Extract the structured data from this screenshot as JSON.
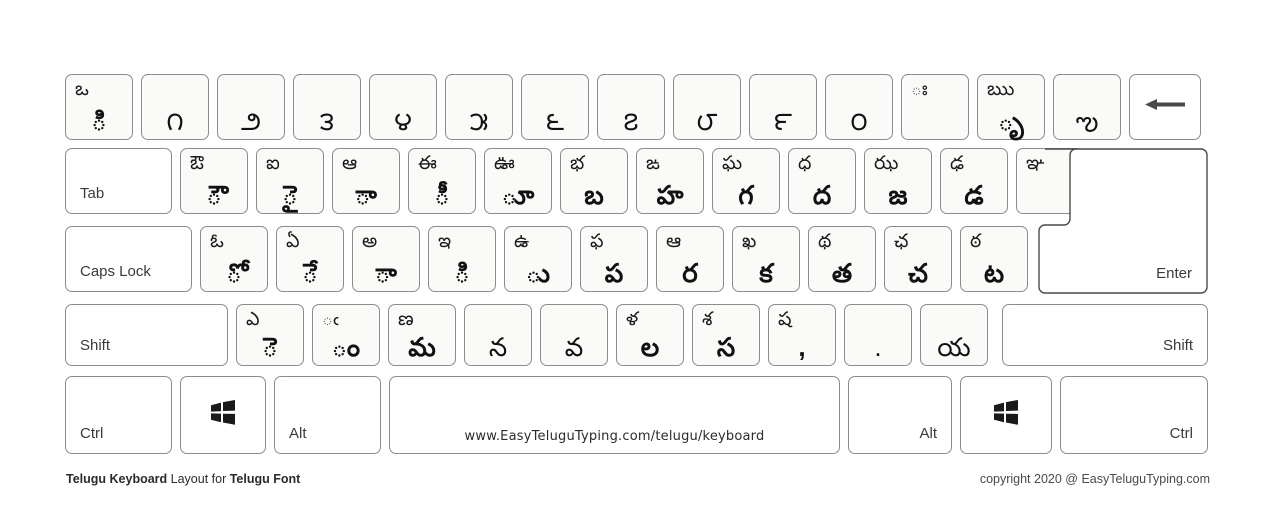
{
  "meta": {
    "title": "Telugu Keyboard Layout for Telugu Font",
    "key_fill": "#fafaf8",
    "key_border": "#8c8c8c",
    "glyph_color": "#111111",
    "label_color": "#3a3a3a"
  },
  "footer": {
    "left_bold_1": "Telugu Keyboard",
    "left_regular": " Layout for ",
    "left_bold_2": "Telugu Font",
    "right": "copyright 2020 @ EasyTeluguTyping.com"
  },
  "spacebar": {
    "label": "www.EasyTeluguTyping.com/telugu/keyboard"
  },
  "rows": {
    "number_row": [
      {
        "name": "key-backquote",
        "top": "ఒ",
        "bottom": "ి"
      },
      {
        "name": "key-1",
        "top": "",
        "bottom": "౧"
      },
      {
        "name": "key-2",
        "top": "",
        "bottom": "౨"
      },
      {
        "name": "key-3",
        "top": "",
        "bottom": "౩"
      },
      {
        "name": "key-4",
        "top": "",
        "bottom": "౪"
      },
      {
        "name": "key-5",
        "top": "",
        "bottom": "౫"
      },
      {
        "name": "key-6",
        "top": "",
        "bottom": "౬"
      },
      {
        "name": "key-7",
        "top": "",
        "bottom": "౭"
      },
      {
        "name": "key-8",
        "top": "",
        "bottom": "౮"
      },
      {
        "name": "key-9",
        "top": "",
        "bottom": "౯"
      },
      {
        "name": "key-0",
        "top": "",
        "bottom": "౦"
      },
      {
        "name": "key-minus",
        "top": "ః",
        "bottom": ""
      },
      {
        "name": "key-equal",
        "top": "ఋ",
        "bottom": "ృ"
      },
      {
        "name": "key-bracketleft-alt",
        "top": "",
        "bottom": "ఌ"
      }
    ],
    "backspace": {
      "name": "backspace-key",
      "icon": "left-arrow-icon"
    },
    "tab_row_lead": {
      "name": "tab-key",
      "label": "Tab"
    },
    "tab_row": [
      {
        "name": "key-q",
        "top": "ఔ",
        "bottom": "ౌ"
      },
      {
        "name": "key-w",
        "top": "ఐ",
        "bottom": "ై"
      },
      {
        "name": "key-e",
        "top": "ఆ",
        "bottom": "ా"
      },
      {
        "name": "key-r",
        "top": "ఈ",
        "bottom": "ీ"
      },
      {
        "name": "key-t",
        "top": "ఊ",
        "bottom": "ూ"
      },
      {
        "name": "key-y",
        "top": "భ",
        "bottom": "బ"
      },
      {
        "name": "key-u",
        "top": "ఙ",
        "bottom": "హ"
      },
      {
        "name": "key-i",
        "top": "ఘ",
        "bottom": "గ"
      },
      {
        "name": "key-o",
        "top": "ధ",
        "bottom": "ద"
      },
      {
        "name": "key-p",
        "top": "ఝ",
        "bottom": "జ"
      },
      {
        "name": "key-bracketleft",
        "top": "ఢ",
        "bottom": "డ"
      },
      {
        "name": "key-bracketright",
        "top": "ఞ",
        "bottom": ""
      }
    ],
    "caps_row_lead": {
      "name": "caps-lock-key",
      "label": "Caps Lock"
    },
    "caps_row": [
      {
        "name": "key-a",
        "top": "ఓ",
        "bottom": "ో"
      },
      {
        "name": "key-s",
        "top": "ఏ",
        "bottom": "ే"
      },
      {
        "name": "key-d",
        "top": "అ",
        "bottom": "ా"
      },
      {
        "name": "key-f",
        "top": "ఇ",
        "bottom": "ి"
      },
      {
        "name": "key-g",
        "top": "ఉ",
        "bottom": "ు"
      },
      {
        "name": "key-h",
        "top": "ఫ",
        "bottom": "ప"
      },
      {
        "name": "key-j",
        "top": "ఆ",
        "bottom": "ర"
      },
      {
        "name": "key-k",
        "top": "ఖ",
        "bottom": "క"
      },
      {
        "name": "key-l",
        "top": "థ",
        "bottom": "త"
      },
      {
        "name": "key-semicolon",
        "top": "ఛ",
        "bottom": "చ"
      },
      {
        "name": "key-quote",
        "top": "ఠ",
        "bottom": "ట"
      }
    ],
    "enter": {
      "name": "enter-key",
      "label": "Enter"
    },
    "shift_row_lead": {
      "name": "shift-left-key",
      "label": "Shift"
    },
    "shift_row": [
      {
        "name": "key-z",
        "top": "ఎ",
        "bottom": "ె"
      },
      {
        "name": "key-x",
        "top": "ఁ",
        "bottom": "ం"
      },
      {
        "name": "key-c",
        "top": "ణ",
        "bottom": "మ"
      },
      {
        "name": "key-v",
        "top": "",
        "bottom": "న"
      },
      {
        "name": "key-b",
        "top": "",
        "bottom": "వ"
      },
      {
        "name": "key-n",
        "top": "ళ",
        "bottom": "ల"
      },
      {
        "name": "key-m",
        "top": "శ",
        "bottom": "స"
      },
      {
        "name": "key-comma",
        "top": "ష",
        "bottom": ","
      },
      {
        "name": "key-period",
        "top": "",
        "bottom": "."
      },
      {
        "name": "key-slash",
        "top": "",
        "bottom": "య"
      }
    ],
    "shift_right": {
      "name": "shift-right-key",
      "label": "Shift"
    },
    "bottom_row": [
      {
        "name": "ctrl-left-key",
        "label": "Ctrl",
        "align": "bl"
      },
      {
        "name": "windows-left-key",
        "label": "",
        "icon": "windows-icon"
      },
      {
        "name": "alt-left-key",
        "label": "Alt",
        "align": "bl"
      },
      {
        "name": "space-key",
        "label": "",
        "icon": ""
      },
      {
        "name": "alt-right-key",
        "label": "Alt",
        "align": "br"
      },
      {
        "name": "windows-right-key",
        "label": "",
        "icon": "windows-icon"
      },
      {
        "name": "ctrl-right-key",
        "label": "Ctrl",
        "align": "br"
      }
    ]
  }
}
